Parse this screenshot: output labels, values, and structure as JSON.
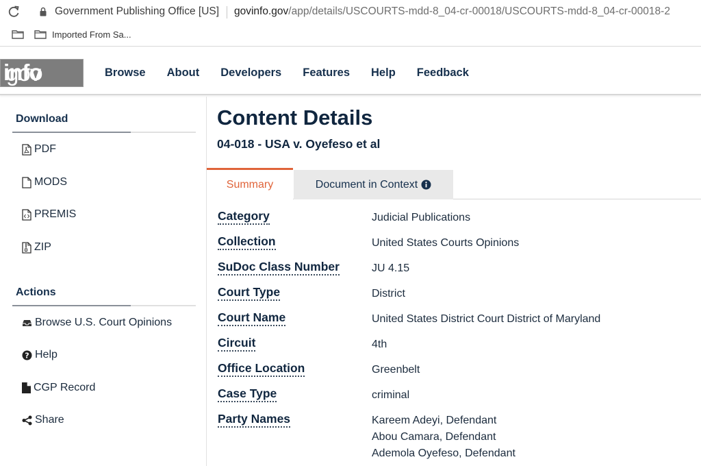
{
  "browser": {
    "site_name": "Government Publishing Office [US]",
    "url_host": "govinfo.gov",
    "url_path": "/app/details/USCOURTS-mdd-8_04-cr-00018/USCOURTS-mdd-8_04-cr-00018-2",
    "bookmark_label": "Imported From Sa..."
  },
  "header": {
    "logo_gov": "gov",
    "logo_info": "info",
    "nav": [
      "Browse",
      "About",
      "Developers",
      "Features",
      "Help",
      "Feedback"
    ]
  },
  "sidebar": {
    "download_heading": "Download",
    "download_items": [
      "PDF",
      "MODS",
      "PREMIS",
      "ZIP"
    ],
    "actions_heading": "Actions",
    "action_items": [
      "Browse U.S. Court Opinions",
      "Help",
      "CGP Record",
      "Share"
    ]
  },
  "main": {
    "title": "Content Details",
    "subtitle": "04-018 - USA v. Oyefeso et al",
    "tabs": {
      "summary": "Summary",
      "context": "Document in Context"
    },
    "accent_color": "#e0643a",
    "details": [
      {
        "label": "Category",
        "value": "Judicial Publications"
      },
      {
        "label": "Collection",
        "value": "United States Courts Opinions"
      },
      {
        "label": "SuDoc Class Number",
        "value": "JU 4.15"
      },
      {
        "label": "Court Type",
        "value": "District"
      },
      {
        "label": "Court Name",
        "value": "United States District Court District of Maryland"
      },
      {
        "label": "Circuit",
        "value": "4th"
      },
      {
        "label": "Office Location",
        "value": "Greenbelt"
      },
      {
        "label": "Case Type",
        "value": "criminal"
      }
    ],
    "party_names": {
      "label": "Party Names",
      "values": [
        "Kareem Adeyi, Defendant",
        "Abou Camara, Defendant",
        "Ademola Oyefeso, Defendant"
      ]
    }
  }
}
